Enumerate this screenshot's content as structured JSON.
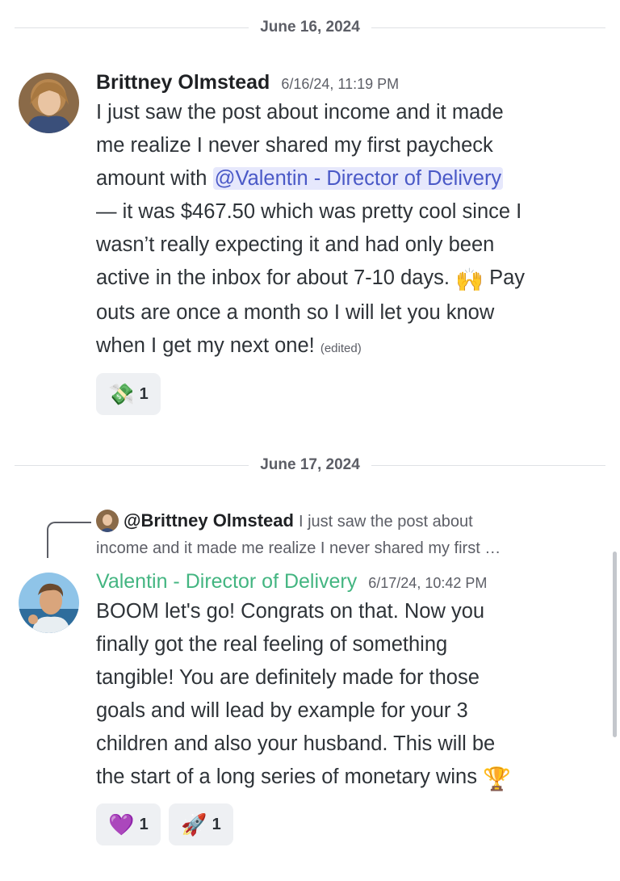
{
  "dividers": [
    "June 16, 2024",
    "June 17, 2024"
  ],
  "message1": {
    "author": "Brittney Olmstead",
    "timestamp": "6/16/24, 11:19 PM",
    "line1": "I just saw the post about income and it made",
    "line2": "me realize I never shared my first paycheck",
    "line3_prefix": "amount with ",
    "mention": "@Valentin - Director of Delivery",
    "line4": "— it was $467.50 which was pretty cool since I",
    "line5": "wasn’t really expecting it and had only been",
    "line6": "active in the inbox for about 7-10 days.",
    "line6_suffix": " Pay",
    "line7": "outs are once a month so I will let you know",
    "line8": "when I get my next one!",
    "edited": "(edited)",
    "reaction": {
      "emoji": "💸",
      "count": "1"
    }
  },
  "reply_context": {
    "name": "@Brittney Olmstead",
    "text1": "I just saw the post about",
    "text2": "income and it made me realize I never shared my first …"
  },
  "message2": {
    "author": "Valentin - Director of Delivery",
    "timestamp": "6/17/24, 10:42 PM",
    "lines": [
      "BOOM let's go! Congrats on that. Now you",
      "finally got the real feeling of something",
      "tangible! You are definitely made for those",
      "goals and will lead by example for your 3",
      "children and also your husband. This will be",
      "the start of a long series of monetary wins"
    ],
    "trailing_emoji": "🏆",
    "reactions": [
      {
        "emoji": "💜",
        "count": "1"
      },
      {
        "emoji": "🚀",
        "count": "1"
      }
    ]
  },
  "colors": {
    "mention_bg": "#e6e8fc",
    "mention_text": "#4a59c7",
    "role_green": "#43b581"
  }
}
